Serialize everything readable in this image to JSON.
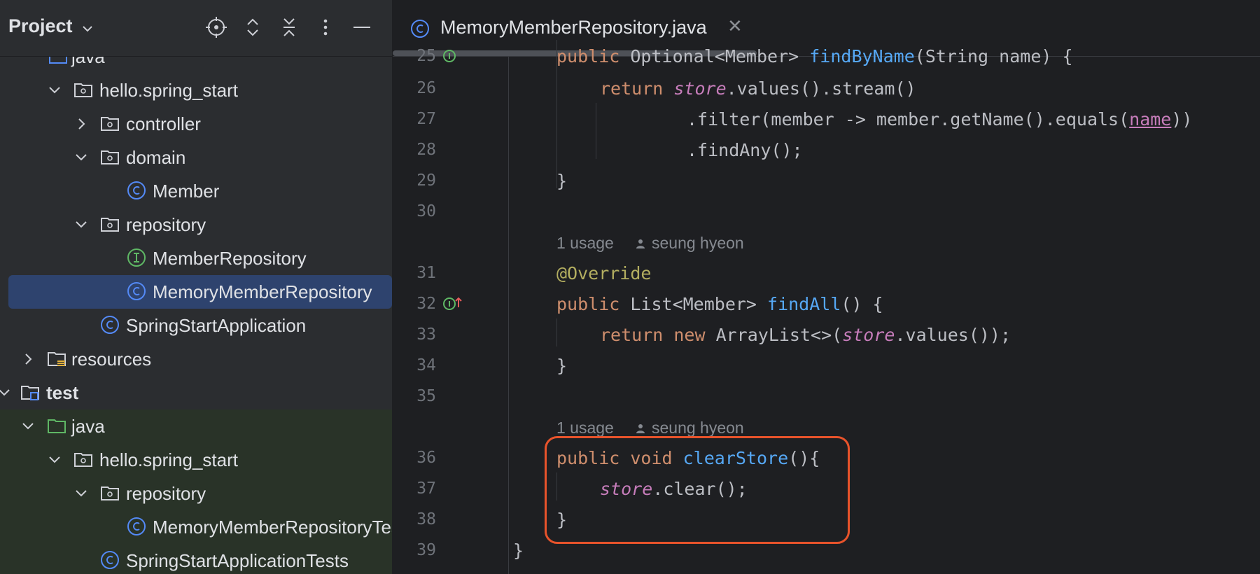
{
  "sidebar": {
    "title": "Project",
    "tree": [
      {
        "label": "java",
        "icon": "source-folder-icon",
        "name": "tree-java-main"
      },
      {
        "label": "hello.spring_start",
        "icon": "package-icon",
        "name": "tree-package-main"
      },
      {
        "label": "controller",
        "icon": "package-icon",
        "name": "tree-controller"
      },
      {
        "label": "domain",
        "icon": "package-icon",
        "name": "tree-domain"
      },
      {
        "label": "Member",
        "icon": "class-icon",
        "name": "tree-member"
      },
      {
        "label": "repository",
        "icon": "package-icon",
        "name": "tree-repository"
      },
      {
        "label": "MemberRepository",
        "icon": "interface-icon",
        "name": "tree-member-repository"
      },
      {
        "label": "MemoryMemberRepository",
        "icon": "class-icon",
        "name": "tree-memory-member-repository"
      },
      {
        "label": "SpringStartApplication",
        "icon": "class-icon",
        "name": "tree-spring-start-application"
      },
      {
        "label": "resources",
        "icon": "resources-folder-icon",
        "name": "tree-resources"
      },
      {
        "label": "test",
        "icon": "test-module-icon",
        "name": "tree-test"
      },
      {
        "label": "java",
        "icon": "test-folder-icon",
        "name": "tree-java-test"
      },
      {
        "label": "hello.spring_start",
        "icon": "package-icon",
        "name": "tree-package-test"
      },
      {
        "label": "repository",
        "icon": "package-icon",
        "name": "tree-repository-test"
      },
      {
        "label": "MemoryMemberRepositoryTest",
        "icon": "class-icon",
        "name": "tree-memory-member-repository-test"
      },
      {
        "label": "SpringStartApplicationTests",
        "icon": "class-icon",
        "name": "tree-spring-start-application-tests"
      }
    ]
  },
  "editor": {
    "tab": {
      "label": "MemoryMemberRepository.java"
    },
    "lines": [
      {
        "num": "25"
      },
      {
        "num": "26"
      },
      {
        "num": "27"
      },
      {
        "num": "28"
      },
      {
        "num": "29"
      },
      {
        "num": "30"
      },
      {
        "num": "31"
      },
      {
        "num": "32"
      },
      {
        "num": "33"
      },
      {
        "num": "34"
      },
      {
        "num": "35"
      },
      {
        "num": "36"
      },
      {
        "num": "37"
      },
      {
        "num": "38"
      },
      {
        "num": "39"
      }
    ],
    "hints": {
      "usage1": "1 usage",
      "author1": "seung hyeon",
      "usage2": "1 usage",
      "author2": "seung hyeon"
    },
    "code": {
      "l25a": "public ",
      "l25b": "Optional<Member> ",
      "l25c": "findByName",
      "l25d": "(String name) {",
      "l26a": "return ",
      "l26b": "store",
      "l26c": ".values().stream()",
      "l27a": ".filter(member -> member.getName().equals(",
      "l27b": "name",
      "l27c": "))",
      "l28a": ".findAny();",
      "l29a": "}",
      "l31a": "@Override",
      "l32a": "public ",
      "l32b": "List<Member> ",
      "l32c": "findAll",
      "l32d": "() {",
      "l33a": "return new ",
      "l33b": "ArrayList<>(",
      "l33c": "store",
      "l33d": ".values());",
      "l34a": "}",
      "l36a": "public void ",
      "l36b": "clearStore",
      "l36c": "(){",
      "l37a": "store",
      "l37b": ".clear();",
      "l38a": "}",
      "l39a": "}"
    }
  },
  "colors": {
    "highlight_border": "#e8532b",
    "selection": "#2e436e",
    "test_background": "#293328"
  }
}
